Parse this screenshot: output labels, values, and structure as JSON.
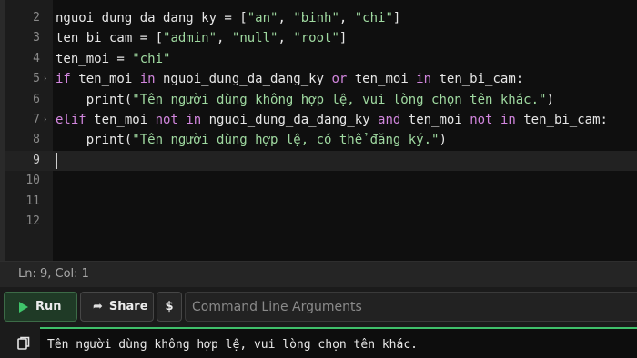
{
  "editor": {
    "line_numbers": [
      "2",
      "3",
      "4",
      "5",
      "6",
      "7",
      "8",
      "9",
      "10",
      "11",
      "12"
    ],
    "lines": [
      [
        {
          "t": "nguoi_dung_da_dang_ky = [",
          "c": ""
        },
        {
          "t": "\"an\"",
          "c": "str"
        },
        {
          "t": ", ",
          "c": ""
        },
        {
          "t": "\"binh\"",
          "c": "str"
        },
        {
          "t": ", ",
          "c": ""
        },
        {
          "t": "\"chi\"",
          "c": "str"
        },
        {
          "t": "]",
          "c": ""
        }
      ],
      [
        {
          "t": "ten_bi_cam = [",
          "c": ""
        },
        {
          "t": "\"admin\"",
          "c": "str"
        },
        {
          "t": ", ",
          "c": ""
        },
        {
          "t": "\"null\"",
          "c": "str"
        },
        {
          "t": ", ",
          "c": ""
        },
        {
          "t": "\"root\"",
          "c": "str"
        },
        {
          "t": "]",
          "c": ""
        }
      ],
      [
        {
          "t": "ten_moi = ",
          "c": ""
        },
        {
          "t": "\"chi\"",
          "c": "str"
        }
      ],
      [
        {
          "t": "if",
          "c": "kw"
        },
        {
          "t": " ten_moi ",
          "c": ""
        },
        {
          "t": "in",
          "c": "kw"
        },
        {
          "t": " nguoi_dung_da_dang_ky ",
          "c": ""
        },
        {
          "t": "or",
          "c": "kw"
        },
        {
          "t": " ten_moi ",
          "c": ""
        },
        {
          "t": "in",
          "c": "kw"
        },
        {
          "t": " ten_bi_cam:",
          "c": ""
        }
      ],
      [
        {
          "t": "    print(",
          "c": ""
        },
        {
          "t": "\"Tên người dùng không hợp lệ, vui lòng chọn tên khác.\"",
          "c": "str"
        },
        {
          "t": ")",
          "c": ""
        }
      ],
      [
        {
          "t": "elif",
          "c": "kw"
        },
        {
          "t": " ten_moi ",
          "c": ""
        },
        {
          "t": "not",
          "c": "kw"
        },
        {
          "t": " ",
          "c": ""
        },
        {
          "t": "in",
          "c": "kw"
        },
        {
          "t": " nguoi_dung_da_dang_ky ",
          "c": ""
        },
        {
          "t": "and",
          "c": "kw"
        },
        {
          "t": " ten_moi ",
          "c": ""
        },
        {
          "t": "not",
          "c": "kw"
        },
        {
          "t": " ",
          "c": ""
        },
        {
          "t": "in",
          "c": "kw"
        },
        {
          "t": " ten_bi_cam:",
          "c": ""
        }
      ],
      [
        {
          "t": "    print(",
          "c": ""
        },
        {
          "t": "\"Tên người dùng hợp lệ, có thể đăng ký.\"",
          "c": "str"
        },
        {
          "t": ")",
          "c": ""
        }
      ],
      [],
      [],
      [],
      []
    ],
    "fold_markers": [
      "",
      "",
      "",
      "›",
      "",
      "›",
      "",
      "",
      "",
      "",
      ""
    ],
    "active_line_index": 7
  },
  "status": {
    "cursor_position": "Ln: 9,  Col: 1"
  },
  "toolbar": {
    "run_label": "Run",
    "share_label": "Share",
    "args_symbol": "$",
    "args_placeholder": "Command Line Arguments"
  },
  "output": {
    "text": "Tên người dùng không hợp lệ, vui lòng chọn tên khác."
  },
  "colors": {
    "keyword": "#d286de",
    "string": "#9fd9a0",
    "run_accent": "#3fc56a"
  },
  "icons": {
    "run": "play-icon",
    "share": "share-icon",
    "output": "copy-icon"
  }
}
